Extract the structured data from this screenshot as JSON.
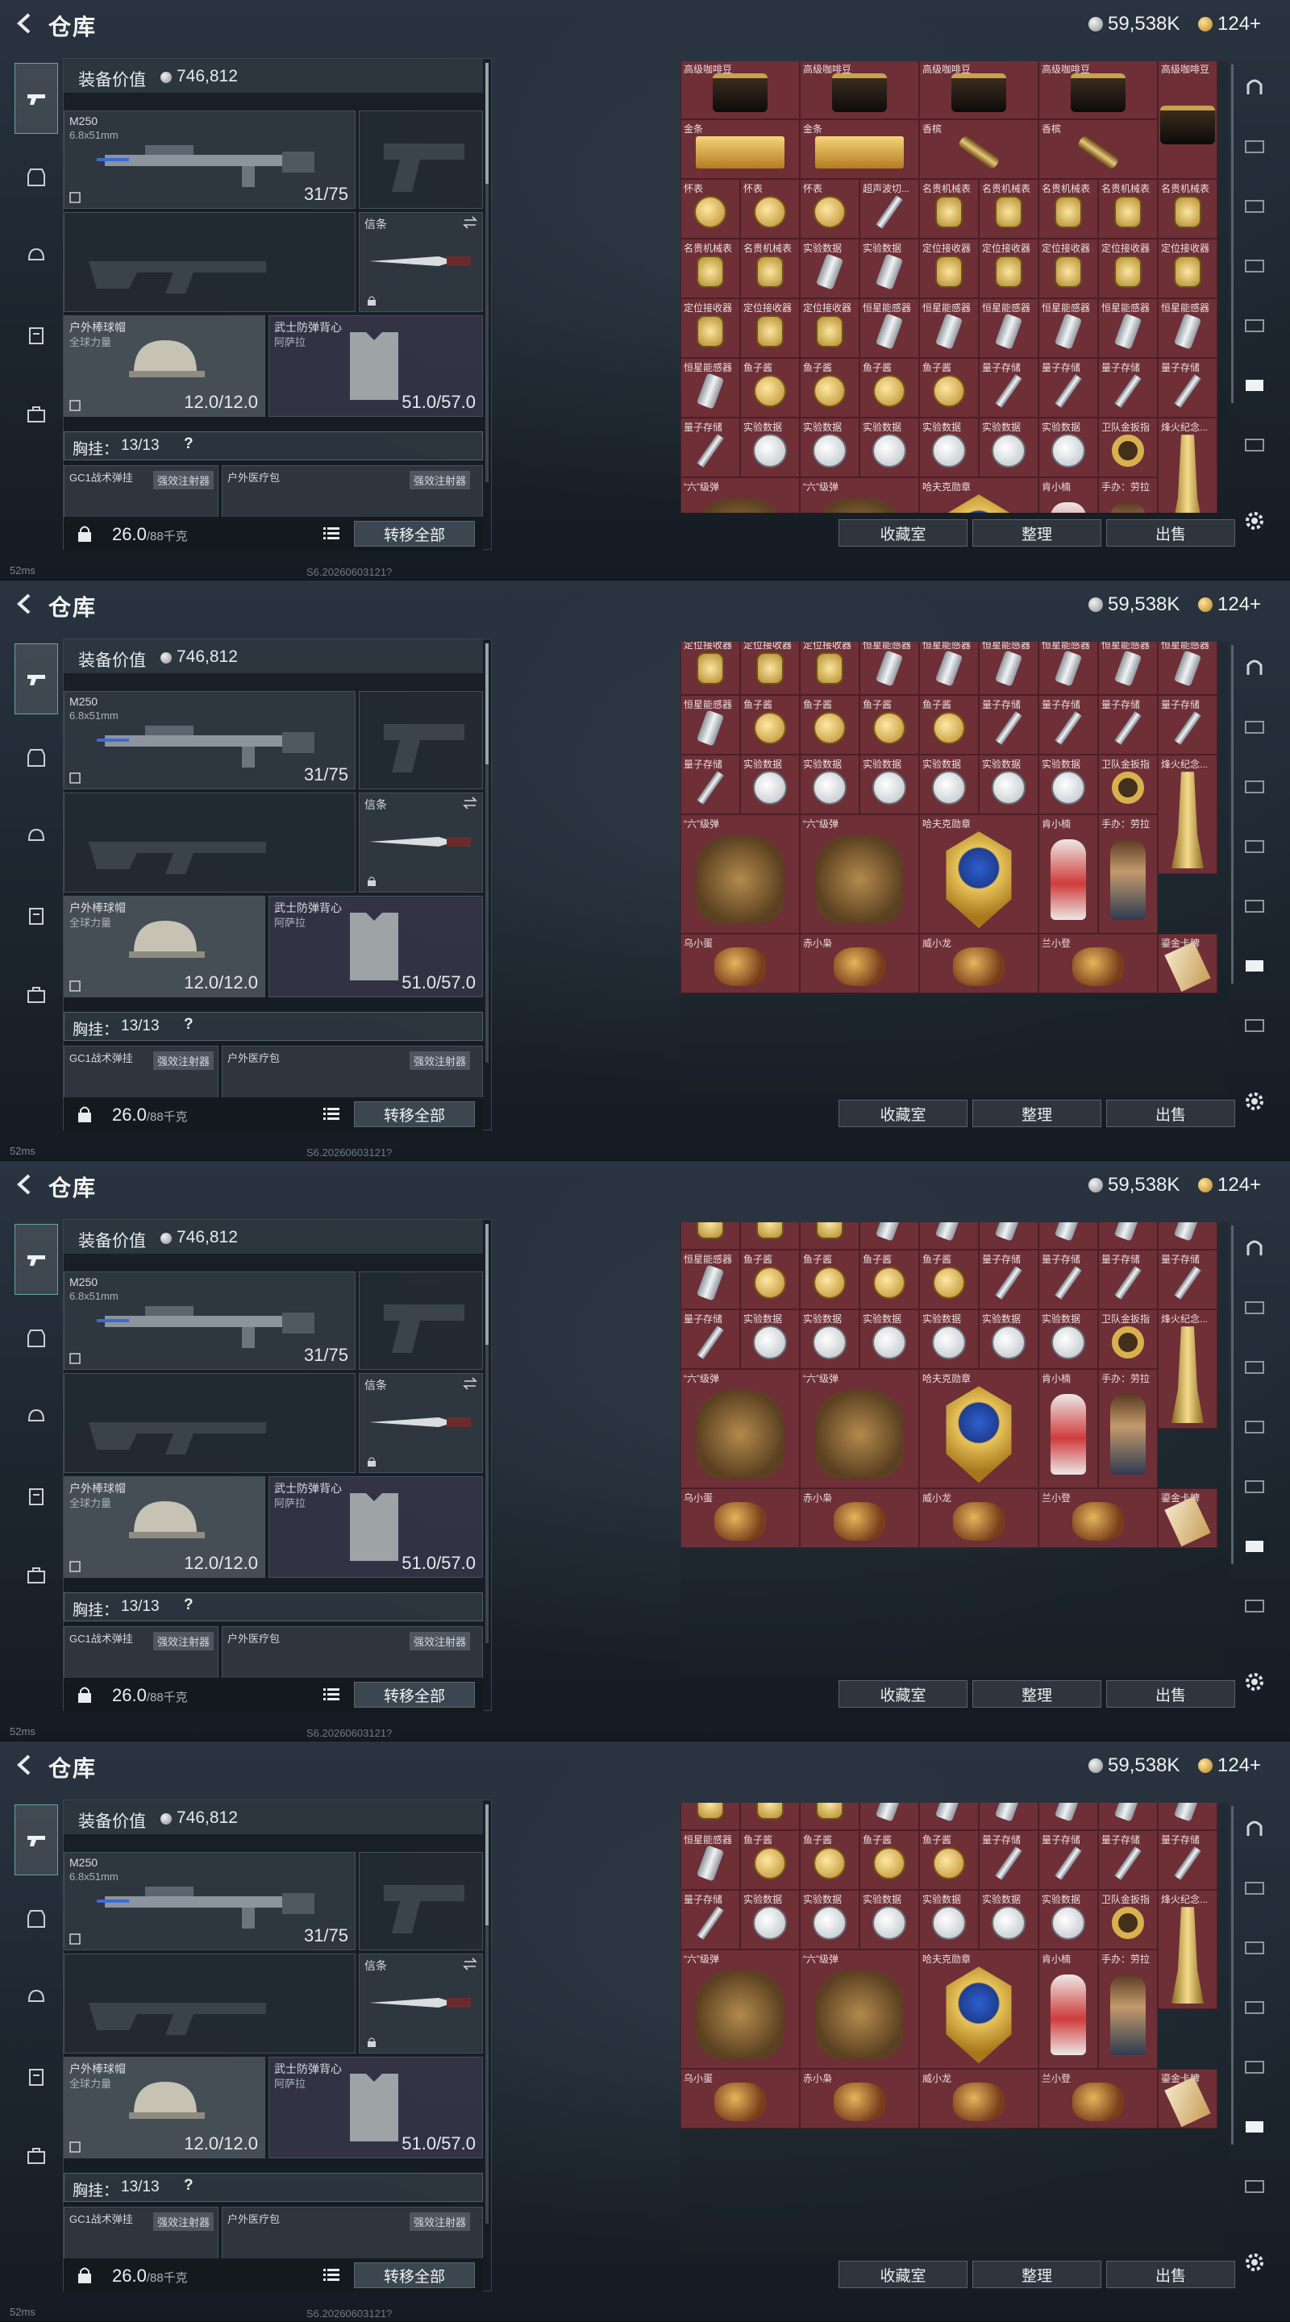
{
  "app": {
    "title": "仓库",
    "silver_amount": "59,538K",
    "gold_amount": "124+"
  },
  "loadout": {
    "value_label": "装备价值",
    "value_amount": "746,812",
    "primary_weapon": {
      "name": "M250",
      "caliber": "6.8x51mm",
      "ammo": "31/75"
    },
    "melee": {
      "name": "信条"
    },
    "helmet": {
      "name": "户外棒球帽",
      "sub": "全球力量",
      "durability": "12.0/12.0"
    },
    "armor": {
      "name": "武士防弹背心",
      "sub": "阿萨拉",
      "durability": "51.0/57.0"
    },
    "chest_rig": {
      "label": "胸挂：",
      "count": "13/13",
      "hint": "?"
    },
    "pouches": [
      {
        "name": "GC1战术弹挂",
        "tag": "强效注射器"
      },
      {
        "name": "户外医疗包",
        "tag": "强效注射器"
      }
    ],
    "weight": "26.0",
    "weight_cap": "/88千克",
    "transfer_all": "转移全部"
  },
  "inventory": {
    "panels": [
      {
        "rows": [
          [
            {
              "l": "高级咖啡豆",
              "a": "bag"
            },
            {
              "l": "高级咖啡豆",
              "a": "bag"
            },
            {
              "l": "高级咖啡豆",
              "a": "bag"
            },
            {
              "l": "高级咖啡豆",
              "a": "bag"
            },
            {
              "l": "高级咖啡豆",
              "a": "bag"
            }
          ],
          [
            {
              "l": "金条",
              "a": "bar"
            },
            {
              "l": "金条",
              "a": "bar"
            },
            {
              "l": "香槟",
              "a": "bottle"
            },
            {
              "l": "香槟",
              "a": "bottle"
            }
          ],
          [
            {
              "l": "怀表",
              "a": "round-gold"
            },
            {
              "l": "怀表",
              "a": "round-gold"
            },
            {
              "l": "怀表",
              "a": "round-gold"
            },
            {
              "l": "超声波切...",
              "a": "stick"
            },
            {
              "l": "名贵机械表",
              "a": "watch"
            },
            {
              "l": "名贵机械表",
              "a": "watch"
            },
            {
              "l": "名贵机械表",
              "a": "watch"
            },
            {
              "l": "名贵机械表",
              "a": "watch"
            },
            {
              "l": "名贵机械表",
              "a": "watch"
            }
          ],
          [
            {
              "l": "名贵机械表",
              "a": "watch"
            },
            {
              "l": "名贵机械表",
              "a": "watch"
            },
            {
              "l": "实验数据",
              "a": "cyl"
            },
            {
              "l": "实验数据",
              "a": "cyl"
            },
            {
              "l": "定位接收器",
              "a": "watch"
            },
            {
              "l": "定位接收器",
              "a": "watch"
            },
            {
              "l": "定位接收器",
              "a": "watch"
            },
            {
              "l": "定位接收器",
              "a": "watch"
            },
            {
              "l": "定位接收器",
              "a": "watch"
            }
          ],
          [
            {
              "l": "定位接收器",
              "a": "watch"
            },
            {
              "l": "定位接收器",
              "a": "watch"
            },
            {
              "l": "定位接收器",
              "a": "watch"
            },
            {
              "l": "恒星能感器",
              "a": "cyl"
            },
            {
              "l": "恒星能感器",
              "a": "cyl"
            },
            {
              "l": "恒星能感器",
              "a": "cyl"
            },
            {
              "l": "恒星能感器",
              "a": "cyl"
            },
            {
              "l": "恒星能感器",
              "a": "cyl"
            },
            {
              "l": "恒星能感器",
              "a": "cyl"
            }
          ],
          [
            {
              "l": "恒星能感器",
              "a": "cyl"
            },
            {
              "l": "鱼子酱",
              "a": "round-gold"
            },
            {
              "l": "鱼子酱",
              "a": "round-gold"
            },
            {
              "l": "鱼子酱",
              "a": "round-gold"
            },
            {
              "l": "鱼子酱",
              "a": "round-gold"
            },
            {
              "l": "量子存储",
              "a": "stick"
            },
            {
              "l": "量子存储",
              "a": "stick"
            },
            {
              "l": "量子存储",
              "a": "stick"
            },
            {
              "l": "量子存储",
              "a": "stick"
            }
          ],
          [
            {
              "l": "量子存储",
              "a": "stick"
            },
            {
              "l": "实验数据",
              "a": "round-white"
            },
            {
              "l": "实验数据",
              "a": "round-white"
            },
            {
              "l": "实验数据",
              "a": "round-white"
            },
            {
              "l": "实验数据",
              "a": "round-white"
            },
            {
              "l": "实验数据",
              "a": "round-white"
            },
            {
              "l": "实验数据",
              "a": "round-white"
            },
            {
              "l": "卫队金扳指",
              "a": "ring"
            },
            {
              "l": "烽火纪念...",
              "a": "trophy"
            }
          ],
          [
            {
              "l": "“六”级弹",
              "a": "hand"
            },
            {
              "l": "“六”级弹",
              "a": "hand"
            },
            {
              "l": "哈夫克勋章",
              "a": "medal"
            },
            {
              "l": "肯小楠",
              "a": "figure"
            },
            {
              "l": "手办：劳拉",
              "a": "figure-brown"
            }
          ]
        ]
      },
      {
        "rows": [
          [
            {
              "l": "定位接收器",
              "a": "watch"
            },
            {
              "l": "定位接收器",
              "a": "watch"
            },
            {
              "l": "定位接收器",
              "a": "watch"
            },
            {
              "l": "恒星能感器",
              "a": "cyl"
            },
            {
              "l": "恒星能感器",
              "a": "cyl"
            },
            {
              "l": "恒星能感器",
              "a": "cyl"
            },
            {
              "l": "恒星能感器",
              "a": "cyl"
            },
            {
              "l": "恒星能感器",
              "a": "cyl"
            },
            {
              "l": "恒星能感器",
              "a": "cyl"
            }
          ],
          [
            {
              "l": "恒星能感器",
              "a": "cyl"
            },
            {
              "l": "鱼子酱",
              "a": "round-gold"
            },
            {
              "l": "鱼子酱",
              "a": "round-gold"
            },
            {
              "l": "鱼子酱",
              "a": "round-gold"
            },
            {
              "l": "鱼子酱",
              "a": "round-gold"
            },
            {
              "l": "量子存储",
              "a": "stick"
            },
            {
              "l": "量子存储",
              "a": "stick"
            },
            {
              "l": "量子存储",
              "a": "stick"
            },
            {
              "l": "量子存储",
              "a": "stick"
            }
          ],
          [
            {
              "l": "量子存储",
              "a": "stick"
            },
            {
              "l": "实验数据",
              "a": "round-white"
            },
            {
              "l": "实验数据",
              "a": "round-white"
            },
            {
              "l": "实验数据",
              "a": "round-white"
            },
            {
              "l": "实验数据",
              "a": "round-white"
            },
            {
              "l": "实验数据",
              "a": "round-white"
            },
            {
              "l": "实验数据",
              "a": "round-white"
            },
            {
              "l": "卫队金扳指",
              "a": "ring"
            },
            {
              "l": "烽火纪念...",
              "a": "trophy"
            }
          ],
          [
            {
              "l": "“六”级弹",
              "a": "hand"
            },
            {
              "l": "“六”级弹",
              "a": "hand"
            },
            {
              "l": "哈夫克勋章",
              "a": "medal"
            },
            {
              "l": "肯小楠",
              "a": "figure"
            },
            {
              "l": "手办：劳拉",
              "a": "figure-brown"
            }
          ],
          [
            {
              "l": "乌小蛋",
              "a": "creature"
            },
            {
              "l": "赤小枭",
              "a": "creature"
            },
            {
              "l": "威小龙",
              "a": "creature"
            },
            {
              "l": "兰小登",
              "a": "creature"
            },
            {
              "l": "鎏金卡牌",
              "a": "card"
            }
          ]
        ]
      }
    ]
  },
  "actions": {
    "collection": "收藏室",
    "organize": "整理",
    "sell": "出售"
  },
  "status": {
    "ping": "52ms",
    "version": "S6.20260603121?"
  }
}
